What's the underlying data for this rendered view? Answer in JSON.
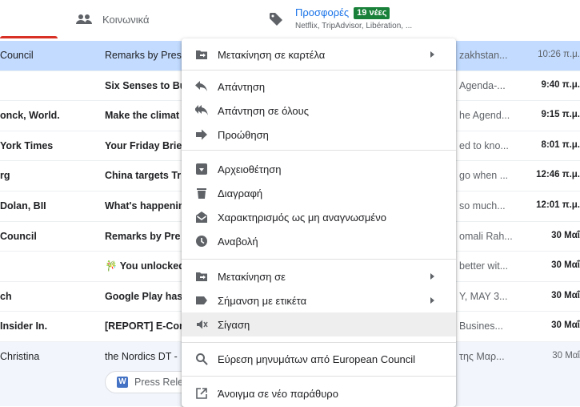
{
  "tabs": {
    "social": {
      "label": "Κοινωνικά"
    },
    "promotions": {
      "label": "Προσφορές",
      "badge": "19 νέες",
      "sub": "Netflix, TripAdvisor, Libération, ..."
    }
  },
  "rows": [
    {
      "sender": "Council",
      "subject": "Remarks by Pres",
      "snippet": "zakhstan...",
      "time": "10:26 π.μ."
    },
    {
      "sender": "",
      "subject": "Six Senses to Bu",
      "snippet": "Agenda-...",
      "time": "9:40 π.μ."
    },
    {
      "sender": "onck, World.",
      "subject": "Make the climat",
      "snippet": "he Agend...",
      "time": "9:15 π.μ."
    },
    {
      "sender": "York Times",
      "subject": "Your Friday Brie",
      "snippet": "ed to kno...",
      "time": "8:01 π.μ."
    },
    {
      "sender": "rg",
      "subject": "China targets Tr",
      "snippet": "go when ...",
      "time": "12:46 π.μ."
    },
    {
      "sender": "Dolan, BII",
      "subject": "What's happenin",
      "snippet": "so much...",
      "time": "12:01 π.μ."
    },
    {
      "sender": "Council",
      "subject": "Remarks by Pre",
      "snippet": "omali Rah...",
      "time": "30 Μαΐ"
    },
    {
      "sender": "",
      "subject": "🎋 You unlocked",
      "snippet": "better wit...",
      "time": "30 Μαΐ"
    },
    {
      "sender": "ch",
      "subject": "Google Play has",
      "snippet": "Y, MAY 3...",
      "time": "30 Μαΐ"
    },
    {
      "sender": "Insider In.",
      "subject": "[REPORT] E-Con",
      "snippet": "Busines...",
      "time": "30 Μαΐ"
    },
    {
      "sender": "Christina",
      "subject": "the Nordics DT -",
      "snippet": "της Μαρ...",
      "time": "30 Μαΐ",
      "attachment": "Press Rele"
    }
  ],
  "menu": {
    "items": [
      {
        "label": "Μετακίνηση σε καρτέλα",
        "icon": "move-to-tab-icon",
        "submenu": true
      },
      {
        "label": "Απάντηση",
        "icon": "reply-icon"
      },
      {
        "label": "Απάντηση σε όλους",
        "icon": "reply-all-icon"
      },
      {
        "label": "Προώθηση",
        "icon": "forward-icon"
      },
      {
        "label": "Αρχειοθέτηση",
        "icon": "archive-icon"
      },
      {
        "label": "Διαγραφή",
        "icon": "delete-icon"
      },
      {
        "label": "Χαρακτηρισμός ως μη αναγνωσμένο",
        "icon": "mark-unread-icon"
      },
      {
        "label": "Αναβολή",
        "icon": "snooze-icon"
      },
      {
        "label": "Μετακίνηση σε",
        "icon": "move-to-icon",
        "submenu": true
      },
      {
        "label": "Σήμανση με ετικέτα",
        "icon": "label-icon",
        "submenu": true
      },
      {
        "label": "Σίγαση",
        "icon": "mute-icon"
      },
      {
        "label": "Εύρεση μηνυμάτων από European Council",
        "icon": "search-icon"
      },
      {
        "label": "Άνοιγμα σε νέο παράθυρο",
        "icon": "open-in-new-icon"
      }
    ]
  },
  "colors": {
    "accent": "#1a73e8",
    "badge": "#188038",
    "selected_row": "#c2dbff",
    "active_tab": "#d93025"
  }
}
